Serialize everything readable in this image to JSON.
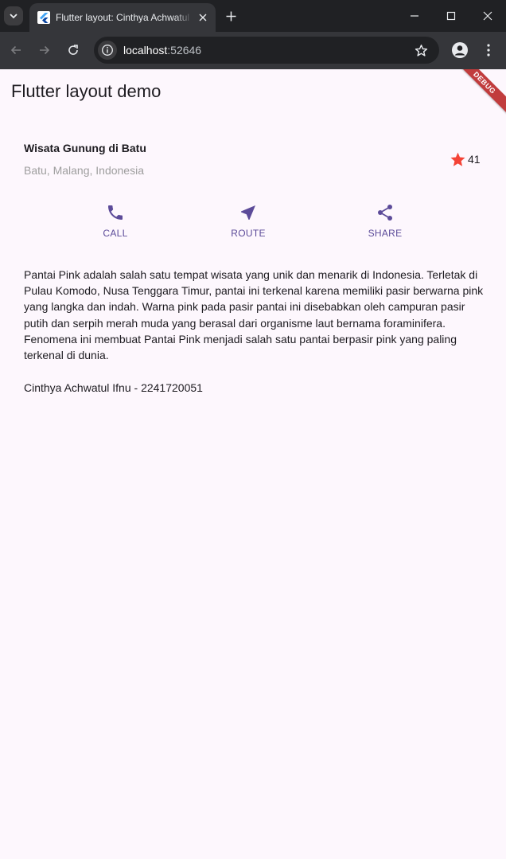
{
  "browser": {
    "tab_title": "Flutter layout: Cinthya Achwatul Ifnu",
    "url_host": "localhost",
    "url_port": ":52646"
  },
  "app": {
    "title": "Flutter layout demo",
    "debug_banner": "DEBUG",
    "place": {
      "title": "Wisata Gunung di Batu",
      "subtitle": "Batu, Malang, Indonesia",
      "rating": "41"
    },
    "actions": [
      {
        "label": "CALL",
        "icon": "phone-icon"
      },
      {
        "label": "ROUTE",
        "icon": "navigation-icon"
      },
      {
        "label": "SHARE",
        "icon": "share-icon"
      }
    ],
    "description": "Pantai Pink adalah salah satu tempat wisata yang unik dan menarik di Indonesia. Terletak di Pulau Komodo, Nusa Tenggara Timur, pantai ini terkenal karena memiliki pasir berwarna pink yang langka dan indah. Warna pink pada pasir pantai ini disebabkan oleh campuran pasir putih dan serpih merah muda yang berasal dari organisme laut bernama foraminifera. Fenomena ini membuat Pantai Pink menjadi salah satu pantai berpasir pink yang paling terkenal di dunia.",
    "author": "Cinthya Achwatul Ifnu - 2241720051"
  },
  "colors": {
    "accent": "#5c4b99",
    "star": "#f44336",
    "background": "#fdf7fd"
  }
}
